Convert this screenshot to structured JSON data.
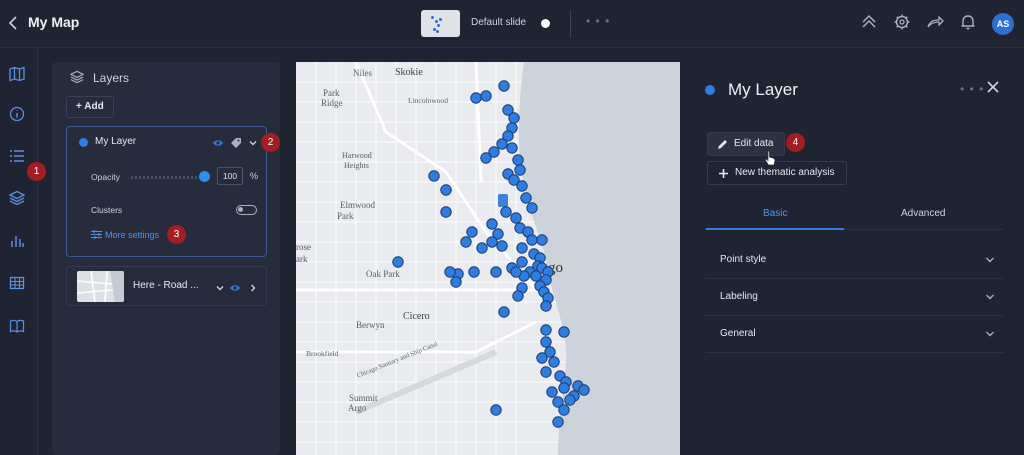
{
  "header": {
    "title": "My Map",
    "slide_label": "Default slide",
    "avatar_initials": "AS"
  },
  "layers_panel": {
    "title": "Layers",
    "add_label": "Add",
    "layer": {
      "name": "My Layer",
      "color": "#2f7de1",
      "opacity_label": "Opacity",
      "opacity_value": "100",
      "opacity_unit": "%",
      "clusters_label": "Clusters",
      "clusters_enabled": false,
      "more_settings_label": "More settings"
    },
    "basemap": {
      "name": "Here - Road ..."
    }
  },
  "callouts": [
    "1",
    "2",
    "3",
    "4"
  ],
  "map": {
    "labels": [
      "Niles",
      "Skokie",
      "Park",
      "Ridge",
      "Lincolnwood",
      "Harwood",
      "Heights",
      "Elmwood",
      "Park",
      "rose",
      "ark",
      "Oak Park",
      "Cicero",
      "Berwyn",
      "Brookfield",
      "Chicago Sanitary and Ship Canal",
      "Summit",
      "Argo",
      "go"
    ]
  },
  "properties": {
    "title": "My Layer",
    "edit_data_label": "Edit data",
    "thematic_label": "New thematic analysis",
    "tabs": [
      {
        "label": "Basic",
        "active": true
      },
      {
        "label": "Advanced",
        "active": false
      }
    ],
    "sections": [
      "Point style",
      "Labeling",
      "General"
    ]
  },
  "colors": {
    "accent": "#2f7de1",
    "badge": "#a41d21",
    "background": "#1f2433"
  }
}
